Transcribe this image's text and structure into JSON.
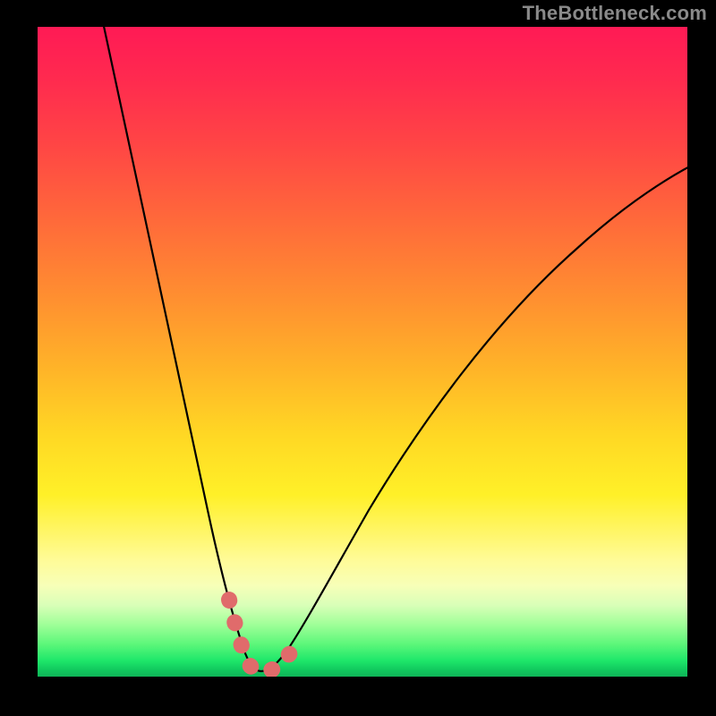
{
  "watermark": "TheBottleneck.com",
  "colors": {
    "frame": "#000000",
    "curve": "#000000",
    "highlight": "#e06b6b",
    "gradient_top": "#ff1a55",
    "gradient_bottom": "#10c85e"
  },
  "chart_data": {
    "type": "line",
    "title": "",
    "xlabel": "",
    "ylabel": "",
    "xlim": [
      0,
      100
    ],
    "ylim": [
      0,
      100
    ],
    "grid": false,
    "legend": false,
    "note": "x and y are percentages of the plot width/height. y=0 is the bottom (green) and y=100 is the top (red). The curve is a V-shape with its minimum near x≈33, y≈0.",
    "series": [
      {
        "name": "bottleneck-curve",
        "x": [
          10,
          13,
          16,
          19,
          22,
          25,
          27,
          29,
          30.5,
          32,
          33,
          34.5,
          36,
          38,
          41,
          45,
          50,
          56,
          63,
          71,
          80,
          90,
          100
        ],
        "y": [
          100,
          87,
          74,
          61,
          48,
          35,
          24,
          15,
          9,
          4,
          1,
          1.5,
          3,
          6,
          11,
          18,
          27,
          36,
          45,
          54,
          63,
          72,
          80
        ]
      }
    ],
    "highlight_segment": {
      "name": "near-minimum-dots",
      "x": [
        29.5,
        30.2,
        30.8,
        31.4,
        32.0,
        32.8,
        33.8,
        34.8,
        35.8,
        36.8,
        37.8
      ],
      "y": [
        11,
        8,
        5.5,
        3.5,
        2.2,
        1.5,
        1.5,
        1.8,
        2.5,
        3.5,
        5
      ]
    }
  }
}
